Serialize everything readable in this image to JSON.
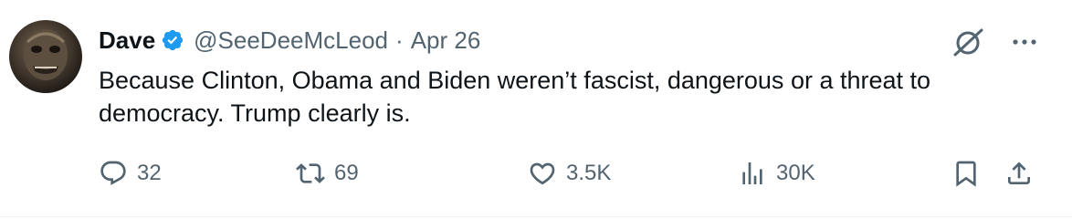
{
  "author": {
    "display_name": "Dave",
    "handle": "@SeeDeeMcLeod",
    "separator": "·",
    "date": "Apr 26",
    "verified": true
  },
  "tweet": {
    "text": "Because Clinton, Obama and Biden weren’t fascist, dangerous or a threat to democracy. Trump clearly is."
  },
  "actions": {
    "replies": "32",
    "reposts": "69",
    "likes": "3.5K",
    "views": "30K"
  },
  "icons": {
    "verified": "verified-badge-icon",
    "grok": "grok-icon",
    "more": "more-icon",
    "reply": "reply-icon",
    "repost": "repost-icon",
    "like": "heart-icon",
    "views": "views-icon",
    "bookmark": "bookmark-icon",
    "share": "share-icon"
  },
  "colors": {
    "text": "#0f1419",
    "secondary": "#536471",
    "verified": "#1d9bf0",
    "border": "#eff3f4"
  }
}
